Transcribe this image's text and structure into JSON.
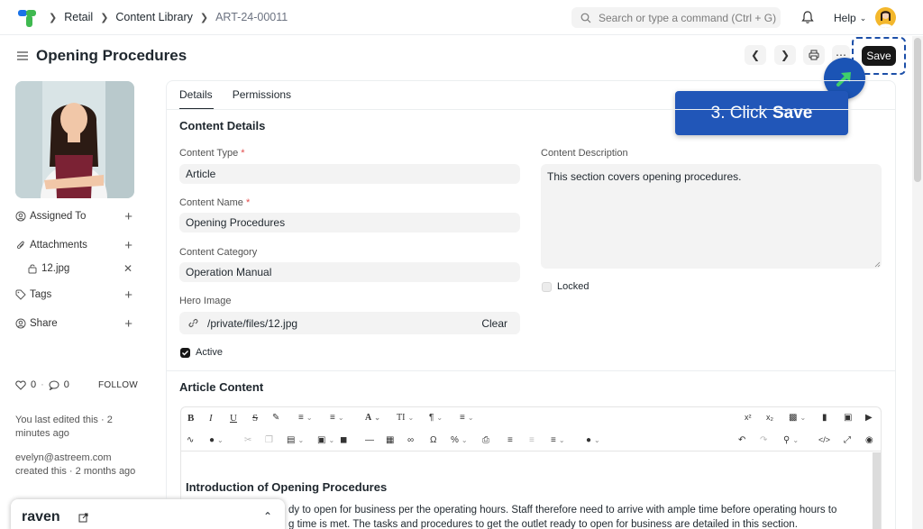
{
  "topnav": {
    "breadcrumbs": [
      "Retail",
      "Content Library",
      "ART-24-00011"
    ],
    "search_placeholder": "Search or type a command (Ctrl + G)",
    "help_label": "Help"
  },
  "header": {
    "title": "Opening Procedures",
    "save_label": "Save",
    "callout_prefix": "3. Click",
    "callout_bold": "Save"
  },
  "sidebar": {
    "assigned_to": "Assigned To",
    "attachments": "Attachments",
    "attachment_file": "12.jpg",
    "tags": "Tags",
    "share": "Share",
    "like_count": "0",
    "comment_count": "0",
    "follow_label": "FOLLOW",
    "last_edited": "You last edited this · 2 minutes ago",
    "creator_email": "evelyn@astreem.com",
    "created": "created this · 2 months ago"
  },
  "tabs": {
    "details": "Details",
    "permissions": "Permissions"
  },
  "form": {
    "section_title": "Content Details",
    "content_type_label": "Content Type",
    "content_type_value": "Article",
    "content_name_label": "Content Name",
    "content_name_value": "Opening Procedures",
    "content_category_label": "Content Category",
    "content_category_value": "Operation Manual",
    "hero_image_label": "Hero Image",
    "hero_image_value": "/private/files/12.jpg",
    "hero_clear": "Clear",
    "active_label": "Active",
    "description_label": "Content Description",
    "description_value": "This section covers opening procedures.",
    "locked_label": "Locked",
    "required_mark": "*"
  },
  "article": {
    "section_title": "Article Content",
    "heading": "Introduction of Opening Procedures",
    "line1": "dy to open for business per the operating hours. Staff therefore need to arrive with ample time before operating hours to",
    "line2": "g time is met. The tasks and procedures to get the outlet ready to open for business are detailed in this section."
  },
  "raven": {
    "name": "raven"
  },
  "colors": {
    "accent": "#2156b8",
    "save_bg": "#171717",
    "logo_green": "#3fb950",
    "logo_blue": "#1a73e8"
  }
}
